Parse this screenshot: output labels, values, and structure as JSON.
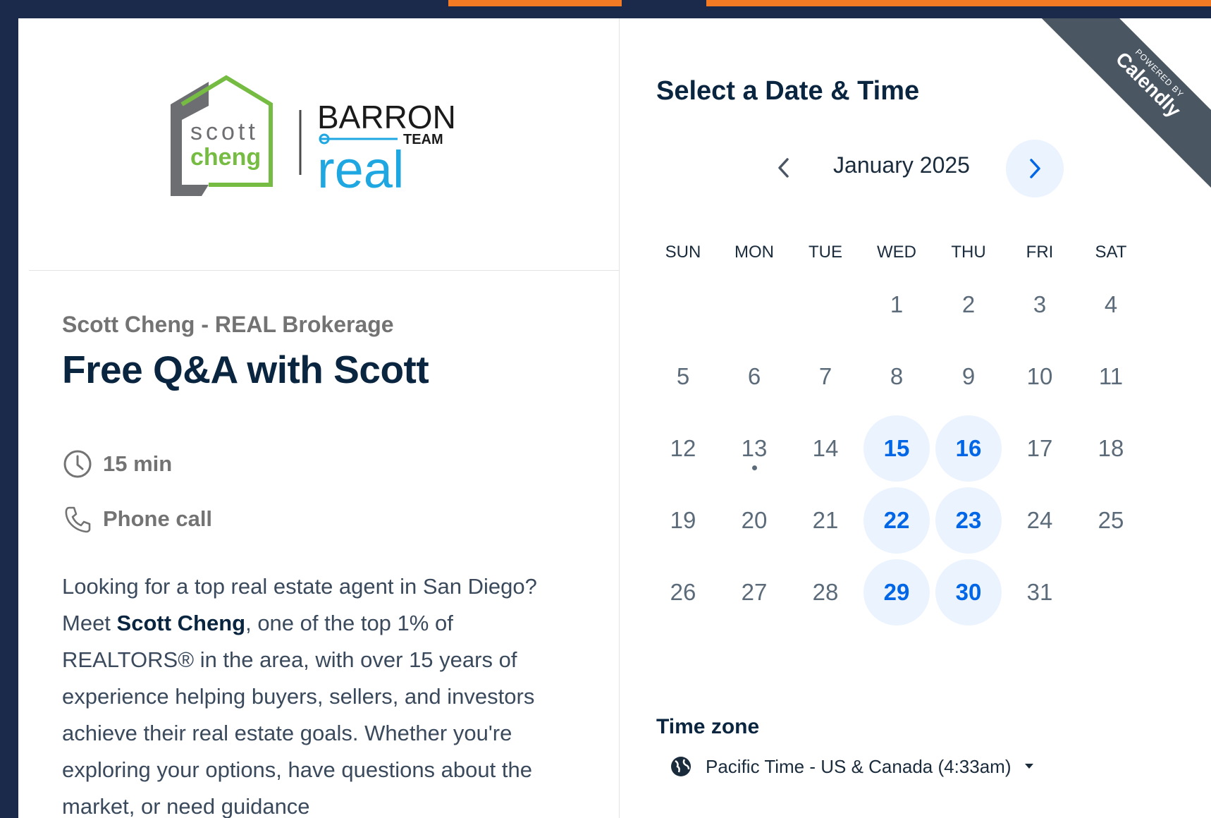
{
  "logo": {
    "scott_line1": "scott",
    "scott_line2": "cheng",
    "barron": "BARRON",
    "team": "TEAM",
    "real": "real"
  },
  "event": {
    "organizer": "Scott Cheng - REAL Brokerage",
    "title": "Free Q&A with Scott",
    "duration": "15 min",
    "location": "Phone call",
    "description_parts": [
      "Looking for a top real estate agent in San Diego? Meet ",
      "Scott Cheng",
      ", one of the top 1% of REALTORS® in the area, with over 15 years of experience helping buyers, sellers, and investors achieve their real estate goals. Whether you're exploring your options, have questions about the market, or need guidance"
    ]
  },
  "calendar": {
    "heading": "Select a Date & Time",
    "month_label": "January 2025",
    "weekdays": [
      "SUN",
      "MON",
      "TUE",
      "WED",
      "THU",
      "FRI",
      "SAT"
    ],
    "first_weekday_index": 3,
    "days_in_month": 31,
    "available_days": [
      15,
      16,
      22,
      23,
      29,
      30
    ],
    "today": 13,
    "colors": {
      "accent": "#0066e6",
      "available_bg": "#ebf3ff"
    }
  },
  "badge": {
    "powered_by": "POWERED BY",
    "brand": "Calendly"
  },
  "timezone": {
    "label": "Time zone",
    "value": "Pacific Time - US & Canada (4:33am)"
  },
  "colors": {
    "frame": "#1b2a4a",
    "orange": "#f47a23",
    "logo_green": "#76bc43",
    "logo_gray": "#6d6e71",
    "logo_blue": "#1ea7e1"
  }
}
